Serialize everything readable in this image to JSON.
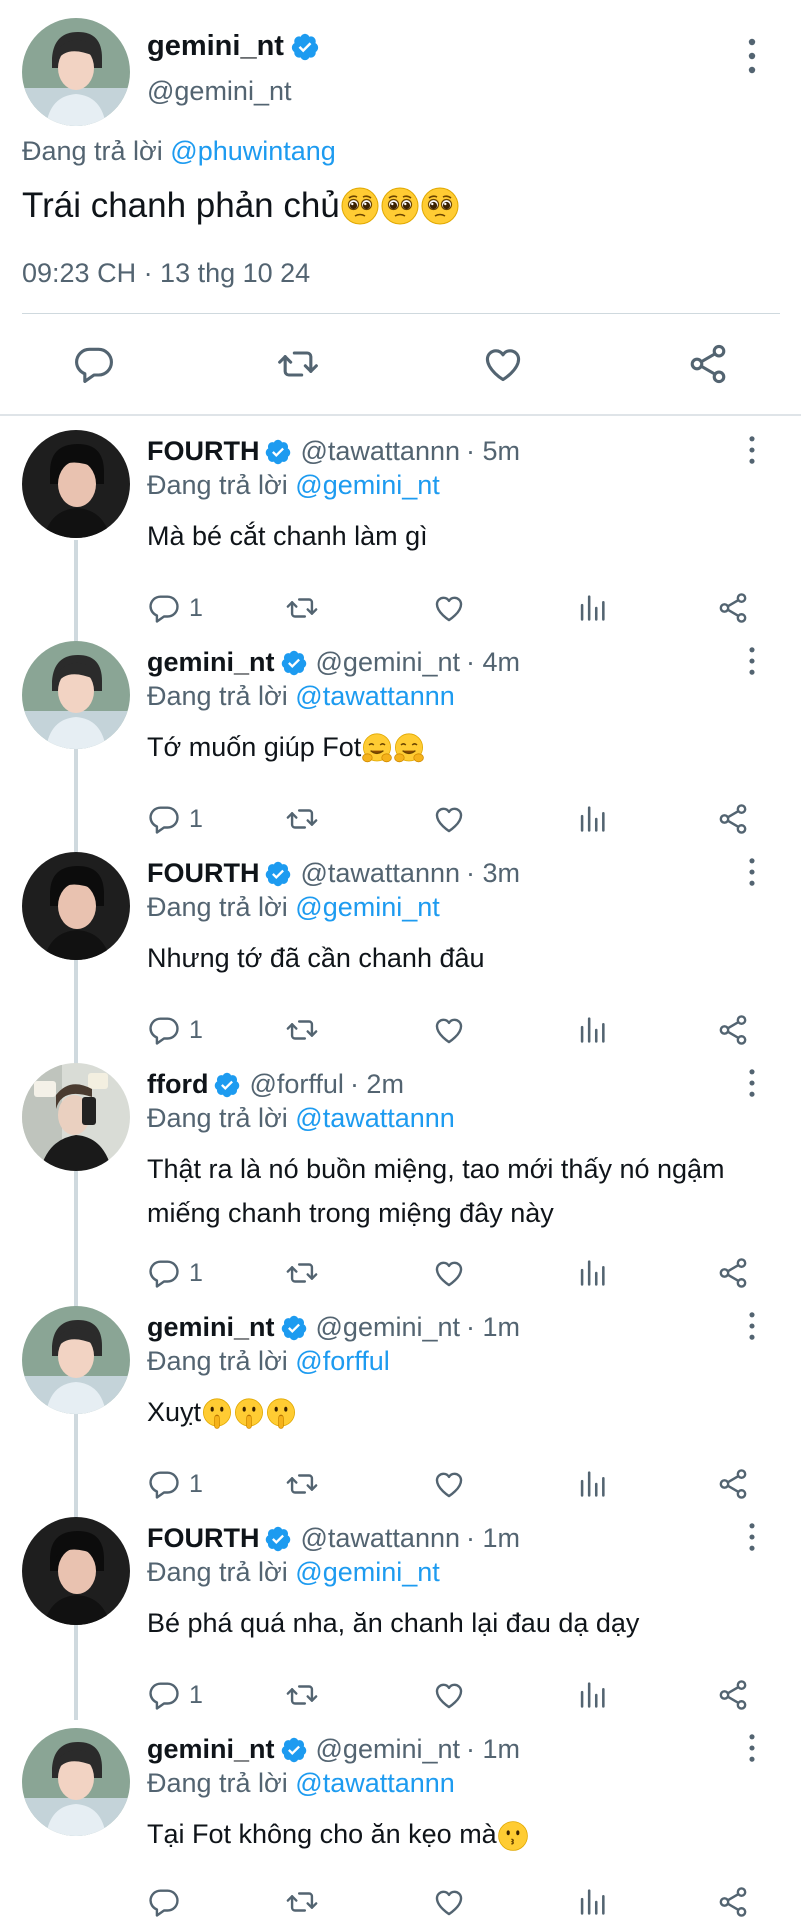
{
  "colors": {
    "accent": "#1d9bf0",
    "muted": "#536471",
    "text": "#0f1419",
    "divider": "#cfd9de"
  },
  "main_tweet": {
    "name": "gemini_nt",
    "handle": "@gemini_nt",
    "replying_prefix": "Đang trả lời",
    "replying_to": "@phuwintang",
    "text": "Trái chanh phản chủ",
    "emojis": [
      "pleading-face-emoji",
      "pleading-face-emoji",
      "pleading-face-emoji"
    ],
    "timestamp": "09:23 CH · 13 thg 10 24",
    "actions": [
      "reply-icon",
      "retweet-icon",
      "like-icon",
      "share-icon"
    ]
  },
  "replies": [
    {
      "name": "FOURTH",
      "handle": "@tawattannn",
      "time": "· 5m",
      "replying_prefix": "Đang trả lời",
      "replying_to": "@gemini_nt",
      "text": "Mà bé cắt chanh làm gì",
      "reply_count": "1"
    },
    {
      "name": "gemini_nt",
      "handle": "@gemini_nt",
      "time": "· 4m",
      "replying_prefix": "Đang trả lời",
      "replying_to": "@tawattannn",
      "text": "Tớ muốn giúp Fot",
      "emojis": [
        "hugging-face-emoji",
        "hugging-face-emoji"
      ],
      "reply_count": "1"
    },
    {
      "name": "FOURTH",
      "handle": "@tawattannn",
      "time": "· 3m",
      "replying_prefix": "Đang trả lời",
      "replying_to": "@gemini_nt",
      "text": "Nhưng tớ đã cần chanh đâu",
      "reply_count": "1"
    },
    {
      "name": "fford",
      "handle": "@forfful",
      "time": "· 2m",
      "replying_prefix": "Đang trả lời",
      "replying_to": "@tawattannn",
      "text": "Thật ra là nó buồn miệng, tao mới thấy nó ngậm miếng chanh trong miệng đây này",
      "reply_count": "1"
    },
    {
      "name": "gemini_nt",
      "handle": "@gemini_nt",
      "time": "· 1m",
      "replying_prefix": "Đang trả lời",
      "replying_to": "@forfful",
      "text": "Xuỵt",
      "emojis": [
        "shushing-face-emoji",
        "shushing-face-emoji",
        "shushing-face-emoji"
      ],
      "reply_count": "1"
    },
    {
      "name": "FOURTH",
      "handle": "@tawattannn",
      "time": "· 1m",
      "replying_prefix": "Đang trả lời",
      "replying_to": "@gemini_nt",
      "text": "Bé phá quá nha, ăn chanh lại đau dạ dạy",
      "reply_count": "1"
    },
    {
      "name": "gemini_nt",
      "handle": "@gemini_nt",
      "time": "· 1m",
      "replying_prefix": "Đang trả lời",
      "replying_to": "@tawattannn",
      "text": "Tại Fot không cho ăn kẹo mà",
      "emojis": [
        "kissing-face-emoji"
      ],
      "reply_count": ""
    }
  ]
}
